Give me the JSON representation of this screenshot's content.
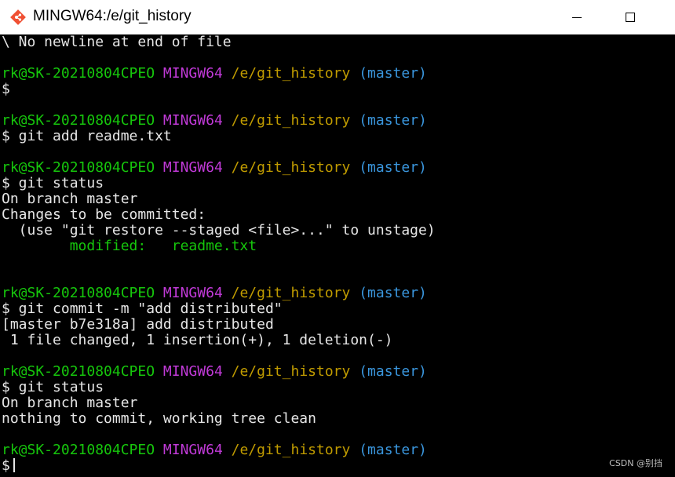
{
  "window": {
    "title": "MINGW64:/e/git_history",
    "icon": "git-bash-icon",
    "controls": [
      "minimize-icon",
      "maximize-icon"
    ]
  },
  "colors": {
    "user": "#16c60c",
    "host": "#c13ad8",
    "path": "#c19c00",
    "branch": "#3a96dd",
    "text": "#e6e6e6",
    "background": "#000000"
  },
  "prompt": {
    "user_host": "rk@SK-20210804CPEO",
    "system": "MINGW64",
    "path": "/e/git_history",
    "branch": "(master)",
    "symbol": "$"
  },
  "lines": {
    "l0": "\\ No newline at end of file",
    "l2": "$",
    "l4": "$ git add readme.txt",
    "l6": "$ git status",
    "l7": "On branch master",
    "l8": "Changes to be committed:",
    "l9": "  (use \"git restore --staged <file>...\" to unstage)",
    "l10": "        modified:   readme.txt",
    "l14": "$ git commit -m \"add distributed\"",
    "l15": "[master b7e318a] add distributed",
    "l16": " 1 file changed, 1 insertion(+), 1 deletion(-)",
    "l18": "$ git status",
    "l19": "On branch master",
    "l20": "nothing to commit, working tree clean",
    "l22": "$"
  },
  "watermark": "CSDN @别挡"
}
